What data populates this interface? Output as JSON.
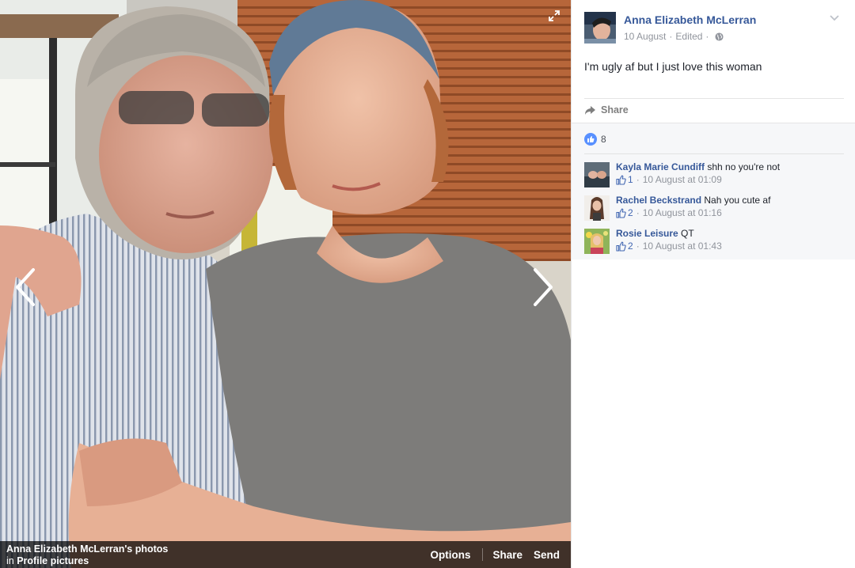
{
  "photo_viewer": {
    "caption_title": "Anna Elizabeth McLerran's photos",
    "caption_in": "in",
    "caption_album": "Profile pictures",
    "actions": {
      "options": "Options",
      "share": "Share",
      "send": "Send"
    },
    "icons": {
      "prev": "chevron-left-icon",
      "next": "chevron-right-icon",
      "expand": "expand-icon"
    }
  },
  "post": {
    "author": "Anna Elizabeth McLerran",
    "date": "10 August",
    "separator": "·",
    "edited": "Edited",
    "text": "I'm ugly af but I just love this woman",
    "share_label": "Share",
    "like_count": "8"
  },
  "comments": [
    {
      "name": "Kayla Marie Cundiff",
      "text": "shh no you're not",
      "likes": "1",
      "time": "10 August at 01:09"
    },
    {
      "name": "Rachel Beckstrand",
      "text": "Nah you cute af",
      "likes": "2",
      "time": "10 August at 01:16"
    },
    {
      "name": "Rosie Leisure",
      "text": "QT",
      "likes": "2",
      "time": "10 August at 01:43"
    }
  ],
  "colors": {
    "link_blue": "#365899",
    "meta_gray": "#90949c",
    "like_blue": "#5890ff",
    "comment_bg": "#f6f7f9"
  }
}
